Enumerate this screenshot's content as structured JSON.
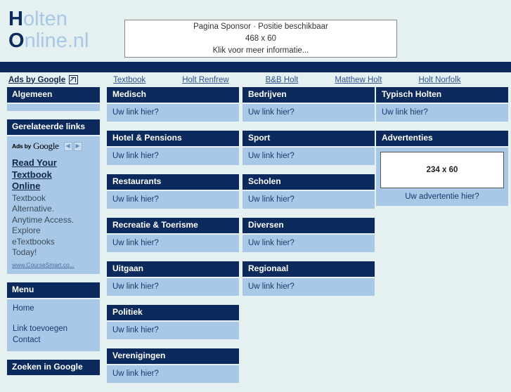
{
  "site": {
    "logo_line1_cap": "H",
    "logo_line1_rest": "olten",
    "logo_line2_cap": "O",
    "logo_line2_rest": "nline.nl"
  },
  "sponsor": {
    "line1": "Pagina Sponsor · Positie beschikbaar",
    "line2": "468 x 60",
    "line3": "Klik voor meer informatie..."
  },
  "adbar": {
    "ads_by_google": "Ads by Google",
    "external_icon": "external-link-icon",
    "keywords": [
      "Textbook",
      "Holt Renfrew",
      "B&B Holt",
      "Matthew Holt",
      "Holt Norfolk"
    ]
  },
  "sidebar": {
    "algemeen": {
      "title": "Algemeen"
    },
    "gerelateerde": {
      "title": "Gerelateerde links",
      "ads_label_small": "Ads by",
      "ads_label_google": "Google",
      "prev_arrow": "◀",
      "next_arrow": "▶",
      "ad_title_line1": "Read Your",
      "ad_title_line2": "Textbook",
      "ad_title_line3": "Online",
      "ad_text_line1": "Textbook",
      "ad_text_line2": "Alternative.",
      "ad_text_line3": "Anytime Access.",
      "ad_text_line4": "Explore",
      "ad_text_line5": "eTextbooks",
      "ad_text_line6": "Today!",
      "ad_url": "www.CourseSmart.co..."
    },
    "menu": {
      "title": "Menu",
      "items": [
        "Home",
        "Link toevoegen",
        "Contact"
      ]
    },
    "zoeken": {
      "title": "Zoeken in Google"
    }
  },
  "link_placeholder": "Uw link hier?",
  "columns": {
    "col1": [
      {
        "title": "Medisch",
        "body": "Uw link hier?"
      },
      {
        "title": "Hotel & Pensions",
        "body": "Uw link hier?"
      },
      {
        "title": "Restaurants",
        "body": "Uw link hier?"
      },
      {
        "title": "Recreatie & Toerisme",
        "body": "Uw link hier?"
      },
      {
        "title": "Uitgaan",
        "body": "Uw link hier?"
      },
      {
        "title": "Politiek",
        "body": "Uw link hier?"
      },
      {
        "title": "Verenigingen",
        "body": "Uw link hier?"
      }
    ],
    "col2": [
      {
        "title": "Bedrijven",
        "body": "Uw link hier?"
      },
      {
        "title": "Sport",
        "body": "Uw link hier?"
      },
      {
        "title": "Scholen",
        "body": "Uw link hier?"
      },
      {
        "title": "Diversen",
        "body": "Uw link hier?"
      },
      {
        "title": "Regionaal",
        "body": "Uw link hier?"
      }
    ],
    "col3": [
      {
        "title": "Typisch Holten",
        "body": "Uw link hier?"
      }
    ],
    "advertenties": {
      "title": "Advertenties",
      "banner_size": "234 x 60",
      "caption": "Uw advertentie hier?"
    }
  },
  "colors": {
    "navy": "#0d2a5c",
    "panel_body": "#a9c8e8",
    "page_bg": "#e5f0f0",
    "link": "#2b5490"
  }
}
